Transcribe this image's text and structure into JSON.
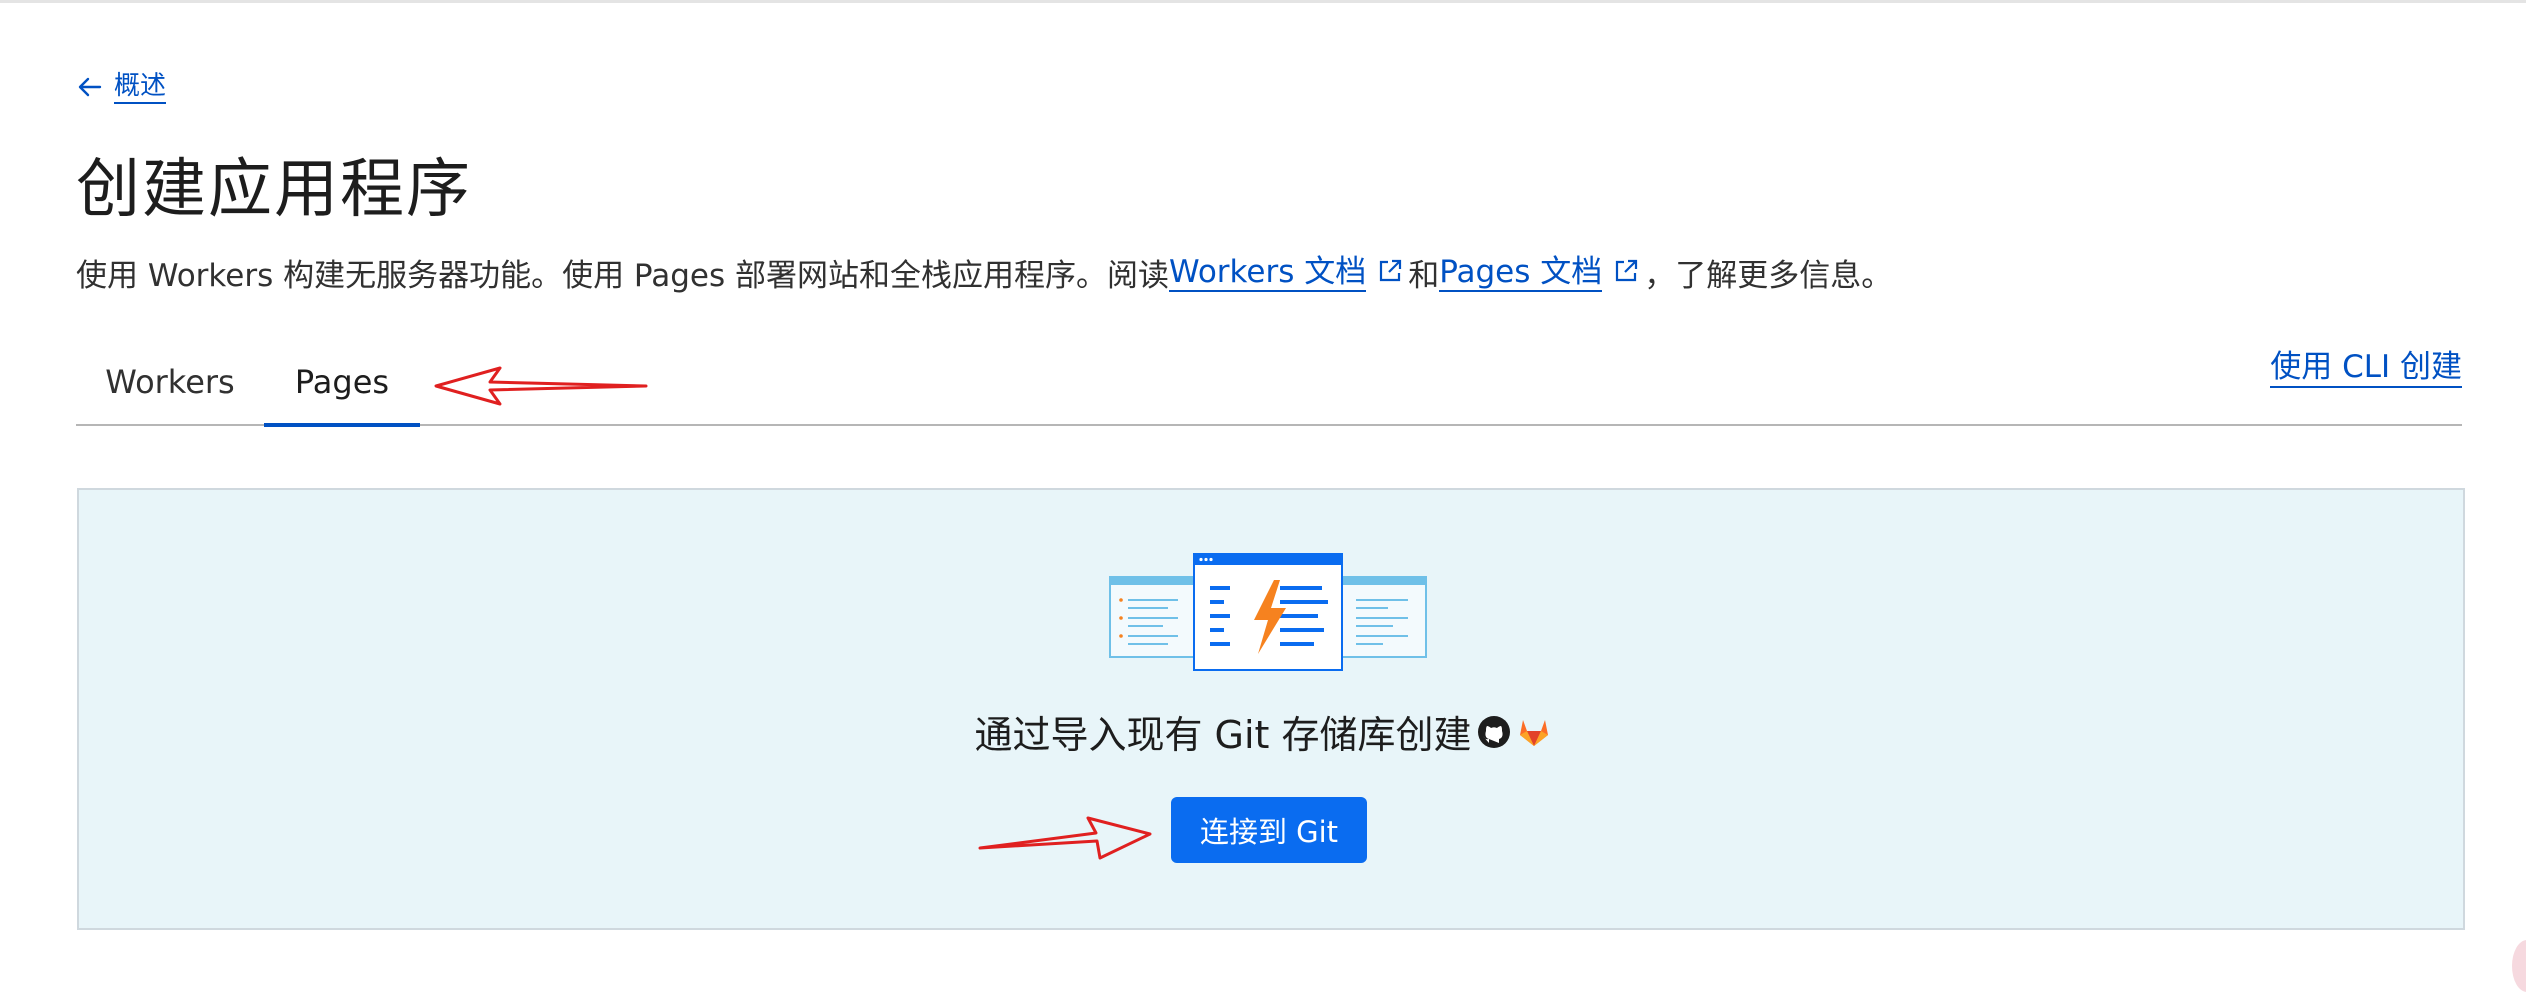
{
  "back": {
    "label": "概述",
    "icon": "arrow-left-icon"
  },
  "page_title": "创建应用程序",
  "description": {
    "text_before": "使用 Workers 构建无服务器功能。使用 Pages 部署网站和全栈应用程序。阅读 ",
    "workers_doc_link": "Workers 文档",
    "connector": "和 ",
    "pages_doc_link": "Pages 文档",
    "text_after": "，了解更多信息。"
  },
  "tabs": [
    {
      "label": "Workers",
      "selected": false
    },
    {
      "label": "Pages",
      "selected": true
    }
  ],
  "cli_link": "使用 CLI 创建",
  "import_panel": {
    "heading": "通过导入现有 Git 存储库创建",
    "providers": [
      "github-icon",
      "gitlab-icon"
    ],
    "button_label": "连接到 Git"
  },
  "colors": {
    "link": "#0051c3",
    "button": "#0a6cf0",
    "panel_bg": "#e8f5f9",
    "annotation_arrow": "#e02020",
    "lightning": "#f6821f"
  }
}
